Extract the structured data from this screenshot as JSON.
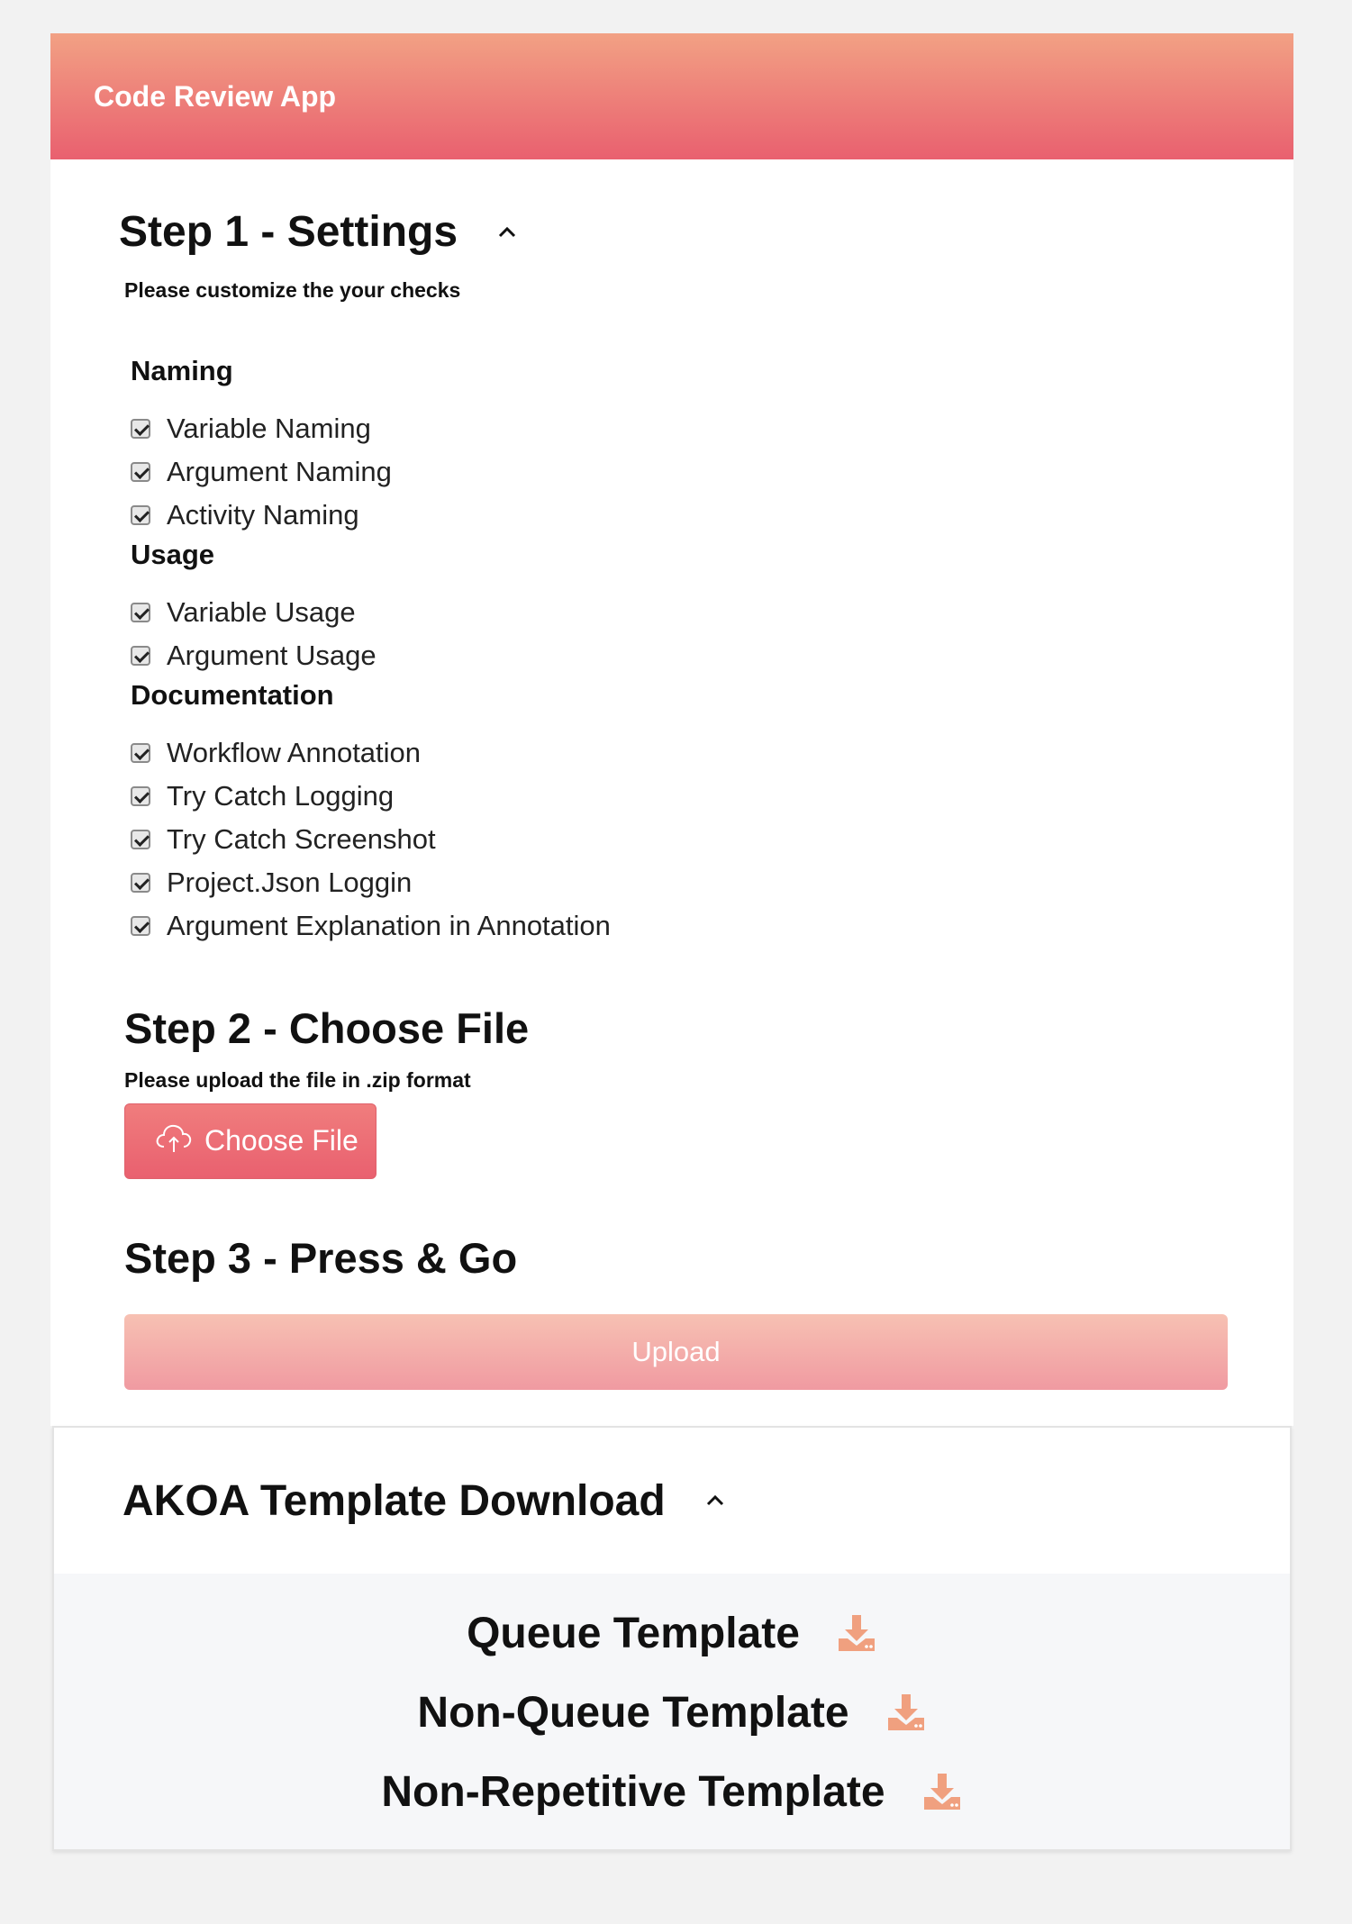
{
  "app": {
    "title": "Code Review App"
  },
  "step1": {
    "title": "Step 1 - Settings",
    "subtitle": "Please customize the your checks",
    "groups": [
      {
        "title": "Naming",
        "items": [
          "Variable Naming",
          "Argument Naming",
          "Activity Naming"
        ]
      },
      {
        "title": "Usage",
        "items": [
          "Variable Usage",
          "Argument Usage"
        ]
      },
      {
        "title": "Documentation",
        "items": [
          "Workflow Annotation",
          "Try Catch Logging",
          "Try Catch Screenshot",
          "Project.Json Loggin",
          "Argument Explanation in Annotation"
        ]
      }
    ]
  },
  "step2": {
    "title": "Step 2 - Choose File",
    "subtitle": "Please upload the file in .zip format",
    "button": "Choose File"
  },
  "step3": {
    "title": "Step 3 - Press & Go",
    "button": "Upload"
  },
  "akoa": {
    "title": "AKOA Template Download",
    "templates": [
      "Queue Template",
      "Non-Queue Template",
      "Non-Repetitive Template"
    ]
  },
  "colors": {
    "accent_top": "#f2a184",
    "accent_bottom": "#e9606f",
    "download_icon": "#f0a07f"
  },
  "icons": {
    "collapse": "chevron-up-icon",
    "upload": "cloud-upload-icon",
    "download": "download-icon"
  }
}
